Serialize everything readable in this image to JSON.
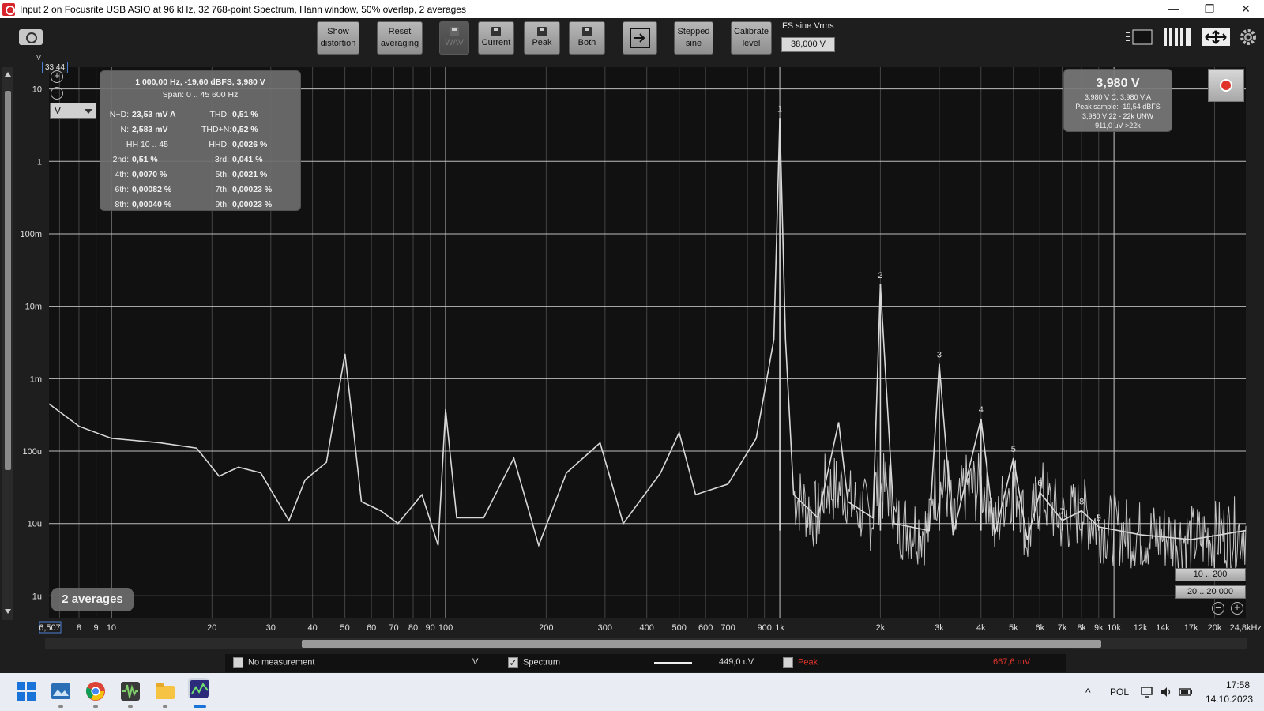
{
  "window": {
    "title": "Input 2 on Focusrite USB ASIO at 96 kHz, 32 768-point Spectrum, Hann window, 50% overlap, 2 averages",
    "controls": [
      "—",
      "❐",
      "✕"
    ]
  },
  "toolbar": {
    "show_distortion": [
      "Show",
      "distortion"
    ],
    "reset_averaging": [
      "Reset",
      "averaging"
    ],
    "wav": "WAV",
    "current": "Current",
    "peak": "Peak",
    "both": "Both",
    "stepped_sine": [
      "Stepped",
      "sine"
    ],
    "calibrate_level": [
      "Calibrate",
      "level"
    ],
    "fs_label": "FS sine Vrms",
    "fs_value": "38,000 V"
  },
  "graph": {
    "y_unit_label": "V",
    "y_top_value": "33,44",
    "unit_select": "V",
    "x_start_value": "6,507",
    "x_unit_suffix": "Hz"
  },
  "distortion_panel": {
    "header": "1 000,00 Hz, -19,60 dBFS, 3,980 V",
    "span": "Span: 0 .. 45 600 Hz",
    "left": [
      {
        "k": "N+D:",
        "v": "23,53 mV A"
      },
      {
        "k": "N:",
        "v": "2,583 mV"
      },
      {
        "k": "HH 10 .. 45",
        "v": ""
      },
      {
        "k": "2nd:",
        "v": "0,51 %"
      },
      {
        "k": "4th:",
        "v": "0,0070 %"
      },
      {
        "k": "6th:",
        "v": "0,00082 %"
      },
      {
        "k": "8th:",
        "v": "0,00040 %"
      }
    ],
    "right": [
      {
        "k": "THD:",
        "v": "0,51 %"
      },
      {
        "k": "THD+N:",
        "v": "0,52 %"
      },
      {
        "k": "HHD:",
        "v": "0,0026 %"
      },
      {
        "k": "3rd:",
        "v": "0,041 %"
      },
      {
        "k": "5th:",
        "v": "0,0021 %"
      },
      {
        "k": "7th:",
        "v": "0,00023 %"
      },
      {
        "k": "9th:",
        "v": "0,00023 %"
      }
    ]
  },
  "level_panel": {
    "big": "3,980 V",
    "line1": "3,980 V C, 3,980 V A",
    "line2": "Peak sample: -19,54 dBFS",
    "line3": "3,980 V 22 - 22k UNW",
    "line4": "911,0 uV >22k"
  },
  "averages_badge": "2 averages",
  "range_buttons": [
    "10 .. 200",
    "20 .. 20 000"
  ],
  "legend": {
    "no_measurement": "No measurement",
    "unit": "V",
    "spectrum": "Spectrum",
    "spectrum_value": "449,0 uV",
    "peak": "Peak",
    "peak_value": "667,6 mV",
    "peak_color": "#e0332a"
  },
  "taskbar": {
    "language": "POL",
    "time": "17:58",
    "date": "14.10.2023",
    "chevron": "^"
  },
  "chart_data": {
    "type": "line",
    "title": "",
    "xlabel": "",
    "ylabel": "",
    "x_scale": "log",
    "y_scale": "log",
    "xlim": [
      6.507,
      24800
    ],
    "ylim": [
      5e-07,
      20
    ],
    "grid": true,
    "y_tick_labels": [
      "10",
      "1",
      "100m",
      "10m",
      "1m",
      "100u",
      "10u",
      "1u"
    ],
    "y_tick_values": [
      10,
      1,
      0.1,
      0.01,
      0.001,
      0.0001,
      1e-05,
      1e-06
    ],
    "x_tick_labels": [
      "6,507",
      "8",
      "9",
      "10",
      "20",
      "30",
      "40",
      "50",
      "60",
      "70",
      "80",
      "90",
      "100",
      "200",
      "300",
      "400",
      "500",
      "600",
      "700",
      "900",
      "1k",
      "2k",
      "3k",
      "4k",
      "5k",
      "6k",
      "7k",
      "8k",
      "9k",
      "10k",
      "12k",
      "14k",
      "17k",
      "20k",
      "24,8kHz"
    ],
    "x_tick_values": [
      6.507,
      8,
      9,
      10,
      20,
      30,
      40,
      50,
      60,
      70,
      80,
      90,
      100,
      200,
      300,
      400,
      500,
      600,
      700,
      900,
      1000,
      2000,
      3000,
      4000,
      5000,
      6000,
      7000,
      8000,
      9000,
      10000,
      12000,
      14000,
      17000,
      20000,
      24800
    ],
    "harmonic_markers": [
      {
        "label": "1",
        "x": 1000,
        "y": 3.98
      },
      {
        "label": "2",
        "x": 2000,
        "y": 0.02
      },
      {
        "label": "3",
        "x": 3000,
        "y": 0.0016
      },
      {
        "label": "4",
        "x": 4000,
        "y": 0.00028
      },
      {
        "label": "5",
        "x": 5000,
        "y": 8e-05
      },
      {
        "label": "6",
        "x": 6000,
        "y": 2.7e-05
      },
      {
        "label": "7",
        "x": 7000,
        "y": 1.1e-05
      },
      {
        "label": "8",
        "x": 8000,
        "y": 1.5e-05
      },
      {
        "label": "9",
        "x": 9000,
        "y": 9e-06
      }
    ],
    "series": [
      {
        "name": "Spectrum",
        "color": "#d8d8d8",
        "points": [
          [
            6.507,
            0.00045
          ],
          [
            8,
            0.00022
          ],
          [
            10,
            0.00015
          ],
          [
            14,
            0.00013
          ],
          [
            18,
            0.00011
          ],
          [
            21,
            4.5e-05
          ],
          [
            24,
            6e-05
          ],
          [
            28,
            5e-05
          ],
          [
            34,
            1.1e-05
          ],
          [
            38,
            4e-05
          ],
          [
            44,
            7e-05
          ],
          [
            50,
            0.0022
          ],
          [
            56,
            2e-05
          ],
          [
            64,
            1.5e-05
          ],
          [
            72,
            1e-05
          ],
          [
            85,
            2.5e-05
          ],
          [
            95,
            5e-06
          ],
          [
            100,
            0.00038
          ],
          [
            108,
            1.2e-05
          ],
          [
            130,
            1.2e-05
          ],
          [
            160,
            8e-05
          ],
          [
            190,
            5e-06
          ],
          [
            230,
            5e-05
          ],
          [
            290,
            0.00013
          ],
          [
            340,
            1e-05
          ],
          [
            440,
            5e-05
          ],
          [
            500,
            0.00018
          ],
          [
            560,
            2.5e-05
          ],
          [
            700,
            3.5e-05
          ],
          [
            850,
            0.00015
          ],
          [
            960,
            0.0035
          ],
          [
            1000,
            3.98
          ],
          [
            1040,
            0.0035
          ],
          [
            1100,
            2.5e-05
          ],
          [
            1300,
            1.2e-05
          ],
          [
            1500,
            0.00025
          ],
          [
            1600,
            2e-05
          ],
          [
            1900,
            1.2e-05
          ],
          [
            2000,
            0.02
          ],
          [
            2200,
            1e-05
          ],
          [
            2800,
            8e-06
          ],
          [
            3000,
            0.0016
          ],
          [
            3300,
            7e-06
          ],
          [
            4000,
            0.00028
          ],
          [
            4400,
            7e-06
          ],
          [
            5000,
            8e-05
          ],
          [
            5500,
            6e-06
          ],
          [
            6000,
            2.7e-05
          ],
          [
            7000,
            1.1e-05
          ],
          [
            8000,
            1.5e-05
          ],
          [
            9000,
            9e-06
          ],
          [
            12000,
            7e-06
          ],
          [
            17000,
            6e-06
          ],
          [
            24800,
            8e-06
          ]
        ]
      }
    ]
  }
}
